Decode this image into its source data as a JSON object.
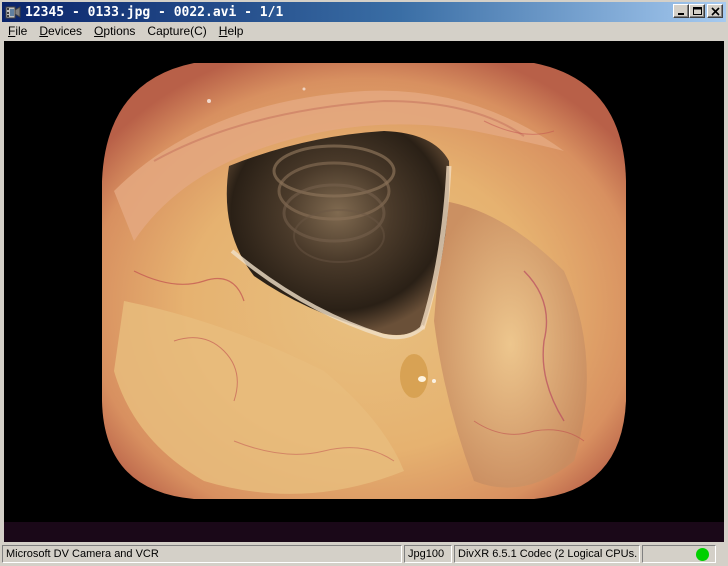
{
  "window": {
    "title": "12345 - 0133.jpg - 0022.avi - 1/1",
    "icon": "film-camera-icon"
  },
  "menu": [
    {
      "label": "File",
      "accel": "F",
      "rest": "ile"
    },
    {
      "label": "Devices",
      "accel": "D",
      "rest": "evices"
    },
    {
      "label": "Options",
      "accel": "O",
      "rest": "ptions"
    },
    {
      "label": "Capture(C)",
      "accel": "",
      "rest": "Capture(C)"
    },
    {
      "label": "Help",
      "accel": "H",
      "rest": "elp"
    }
  ],
  "video": {
    "content": "endoscopic-larynx-frame"
  },
  "status": {
    "device": "Microsoft DV Camera and VCR",
    "format": "Jpg100",
    "codec": "DivXR 6.5.1 Codec (2 Logical CPUs.",
    "indicator_color": "#00d000"
  },
  "colors": {
    "titlebar_start": "#0a246a",
    "titlebar_end": "#a6caf0",
    "face": "#d4d0c8"
  }
}
